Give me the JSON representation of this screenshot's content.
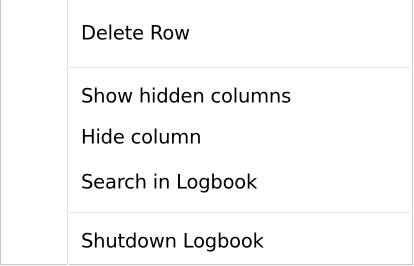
{
  "context_menu": {
    "items": [
      {
        "label": "Delete Row"
      },
      {
        "label": "Show hidden columns"
      },
      {
        "label": "Hide column"
      },
      {
        "label": "Search in Logbook"
      },
      {
        "label": "Shutdown Logbook"
      }
    ]
  }
}
